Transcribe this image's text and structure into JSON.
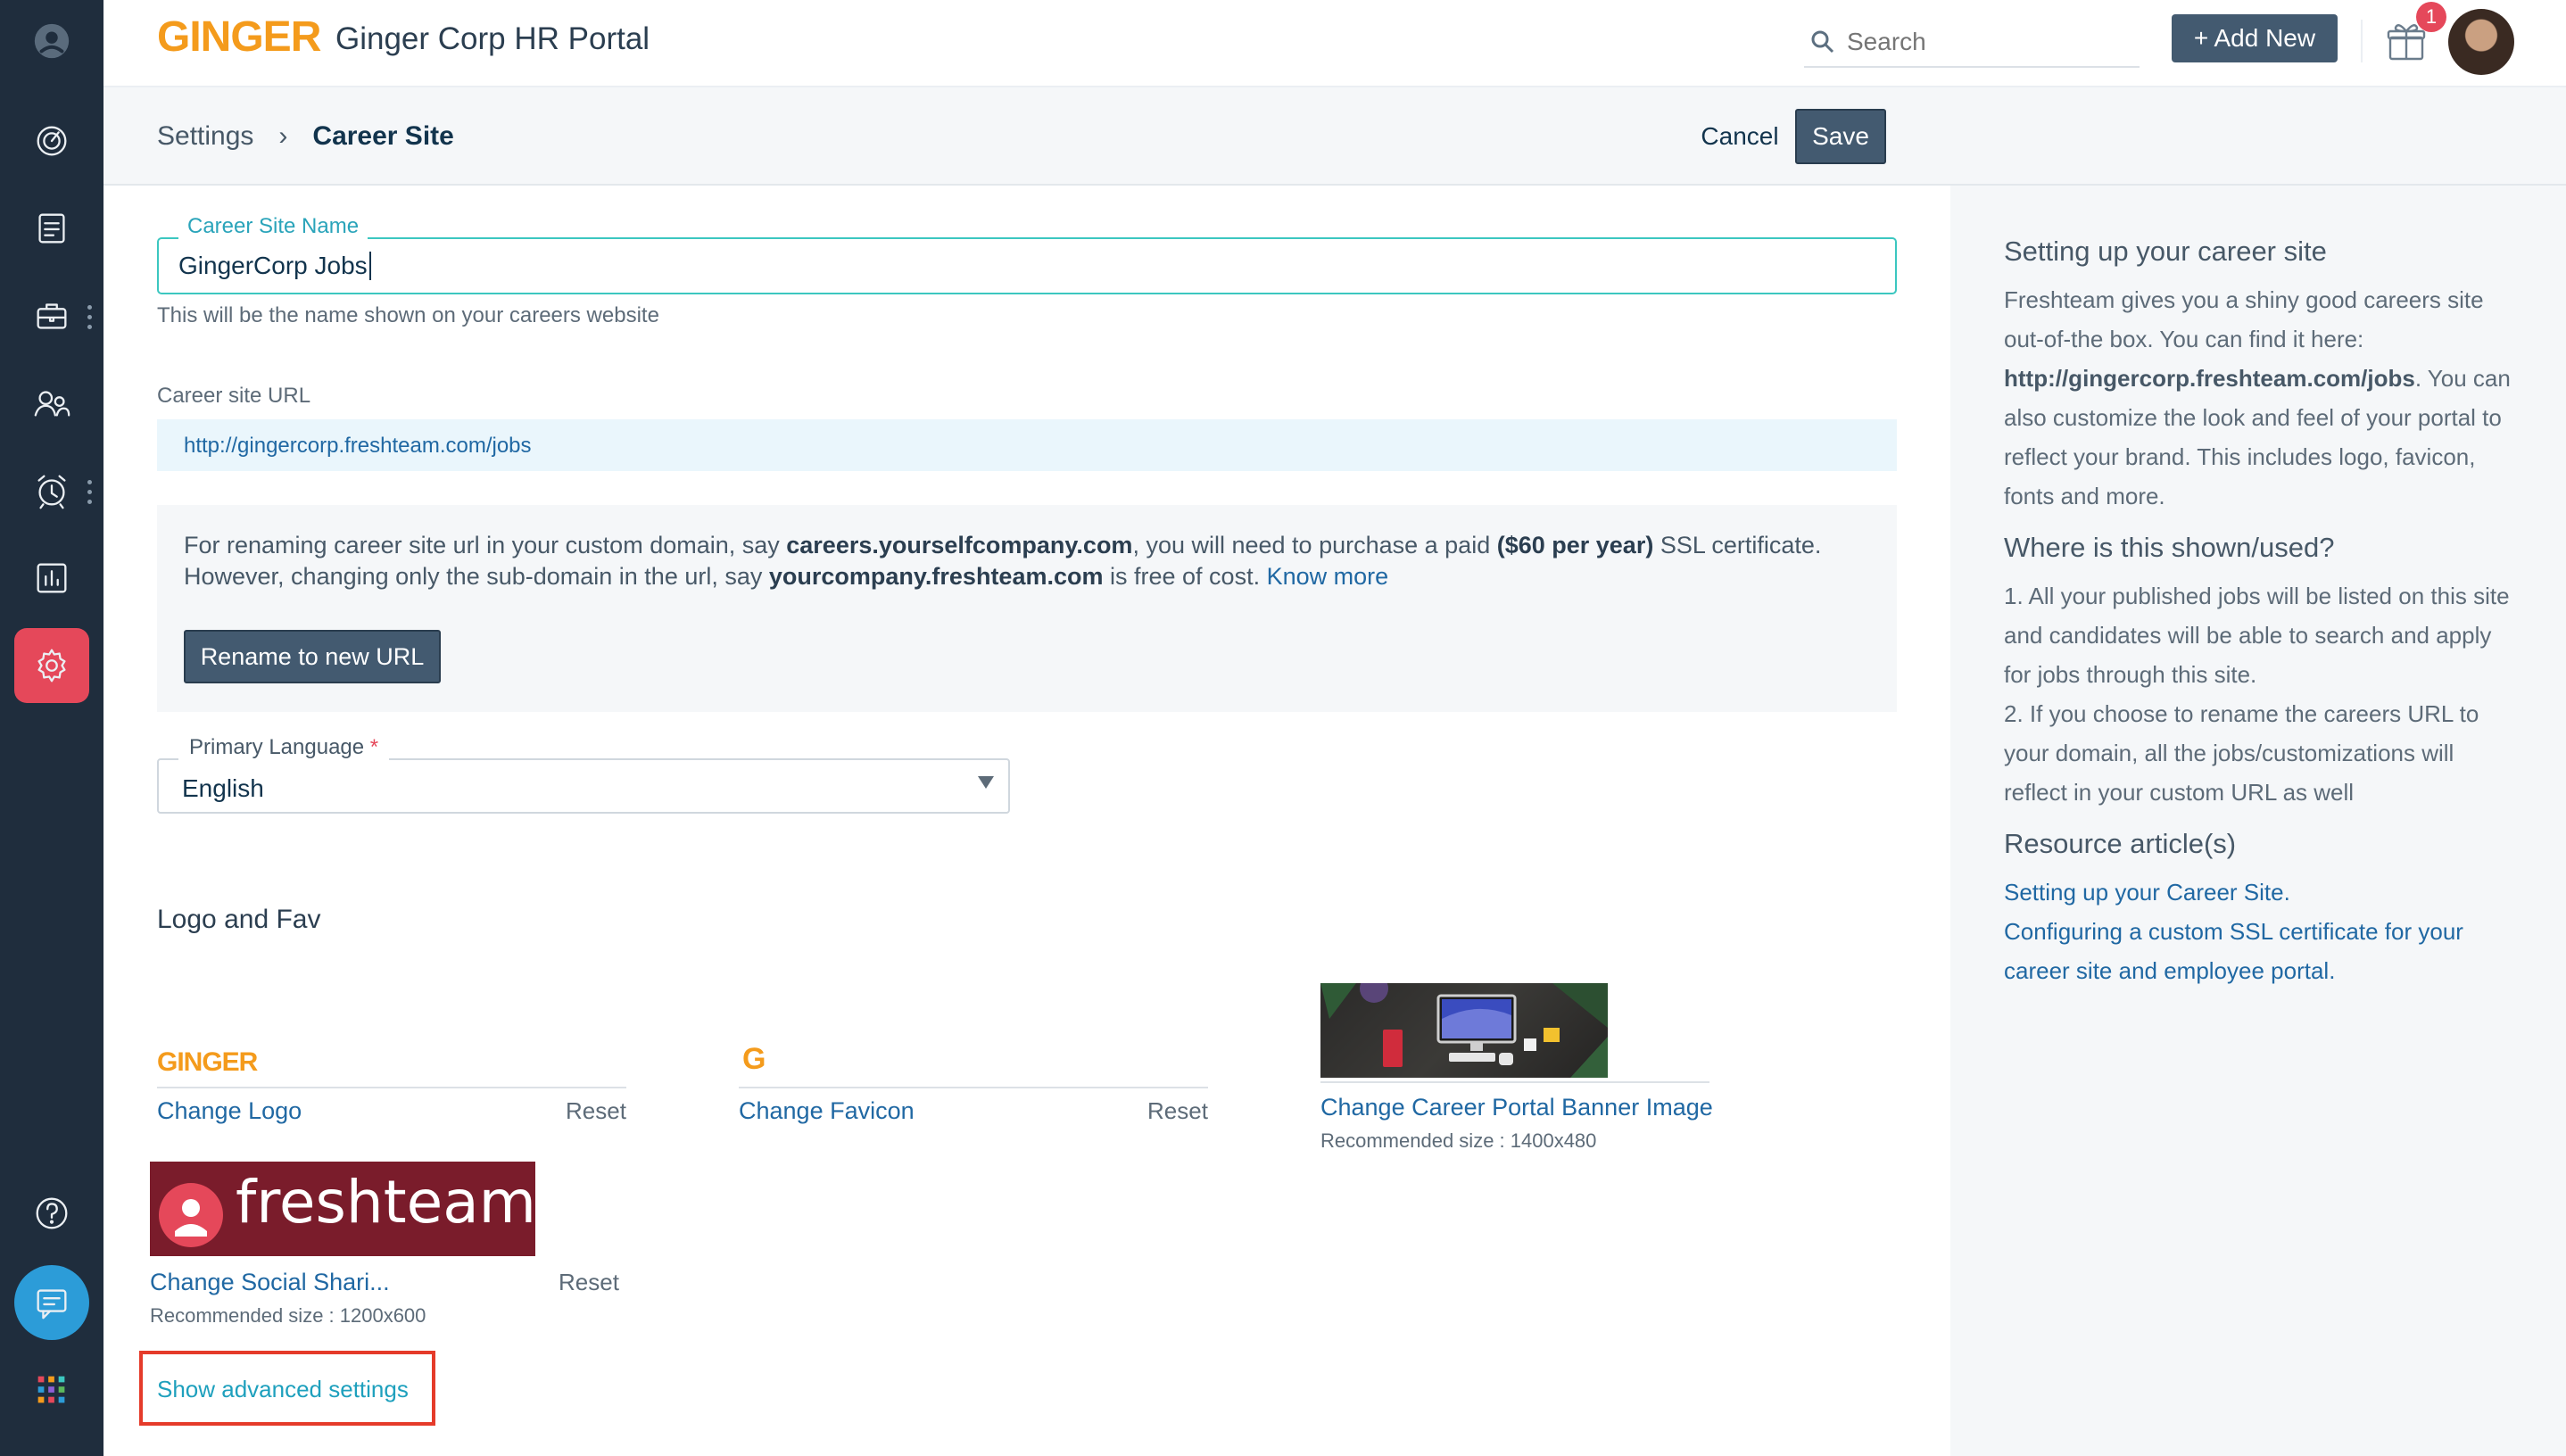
{
  "app": {
    "logo": "GINGER",
    "title": "Ginger Corp HR Portal"
  },
  "header": {
    "search_placeholder": "Search",
    "add_new_label": "+ Add New",
    "notification_count": "1"
  },
  "breadcrumb": {
    "parent": "Settings",
    "current": "Career Site"
  },
  "actions": {
    "cancel": "Cancel",
    "save": "Save"
  },
  "form": {
    "career_site_name_label": "Career Site Name",
    "career_site_name_value": "GingerCorp Jobs",
    "career_site_name_help": "This will be the name shown on your careers website",
    "career_site_url_label": "Career site URL",
    "career_site_url_value": "http://gingercorp.freshteam.com/jobs",
    "rename_info": {
      "t1": "For renaming career site url in your custom domain, say ",
      "b1": "careers.yourselfcompany.com",
      "t2": ", you will need to purchase a paid ",
      "b2": "($60 per year)",
      "t3": " SSL certificate.",
      "t4": "However, changing only the sub-domain in the url, say ",
      "b3": "yourcompany.freshteam.com",
      "t5": " is free of cost. ",
      "link": "Know more"
    },
    "rename_button": "Rename to new URL",
    "primary_language_label": "Primary Language",
    "primary_language_required": "*",
    "primary_language_value": "English"
  },
  "logo_section": {
    "title": "Logo and Fav",
    "logo": {
      "preview": "GINGER",
      "link": "Change Logo",
      "reset": "Reset"
    },
    "favicon": {
      "preview": "G",
      "link": "Change Favicon",
      "reset": "Reset"
    },
    "banner": {
      "link": "Change Career Portal Banner Image",
      "recommended": "Recommended size : 1400x480"
    },
    "social": {
      "preview_text": "freshteam",
      "link": "Change Social Shari...",
      "reset": "Reset",
      "recommended": "Recommended size : 1200x600"
    },
    "advanced_link": "Show advanced settings"
  },
  "help_panel": {
    "h1": "Setting up your career site",
    "p1a": "Freshteam gives you a shiny good careers site out-of-the box. You can find it here: ",
    "p1b": "http://gingercorp.freshteam.com/jobs",
    "p1c": ". You can also customize the look and feel of your portal to reflect your brand. This includes logo, favicon, fonts and more.",
    "h2": "Where is this shown/used?",
    "p2": "1. All your published jobs will be listed on this site and candidates will be able to search and apply for jobs through this site.",
    "p3": "2. If you choose to rename the careers URL to your domain, all the jobs/customizations will reflect in your custom URL as well",
    "h3": "Resource article(s)",
    "link1": "Setting up your Career Site.",
    "link2": "Configuring a custom SSL certificate for your career site and employee portal."
  },
  "colors": {
    "sidebar_bg": "#1f2d3d",
    "active_nav": "#e5485a",
    "primary_button": "#435a70",
    "link": "#2068a3",
    "focus_border": "#3cc7c0",
    "highlight_box": "#e53b2a",
    "brand_orange": "#f49b1c"
  },
  "icons": {
    "sidebar": [
      "user-profile-icon",
      "dashboard-icon",
      "documents-icon",
      "briefcase-icon",
      "people-icon",
      "alarm-clock-icon",
      "reports-icon",
      "settings-icon",
      "help-icon",
      "chat-icon",
      "apps-grid-icon"
    ],
    "header": [
      "search-icon",
      "gift-icon"
    ]
  }
}
